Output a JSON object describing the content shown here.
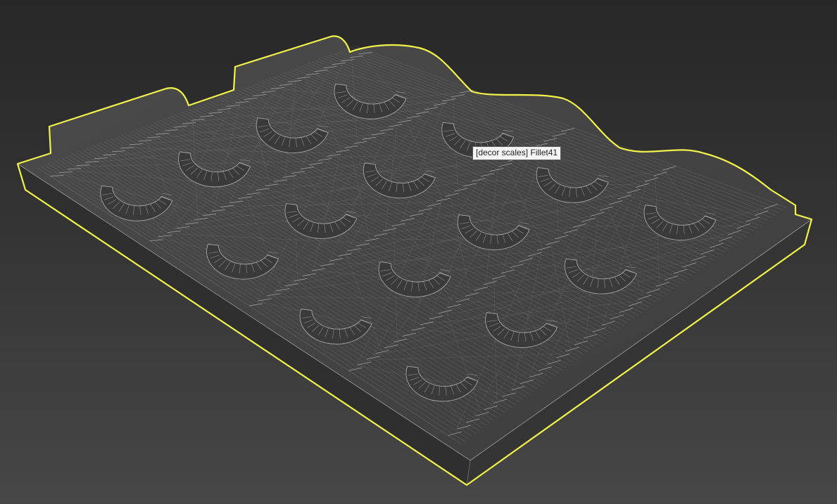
{
  "viewport": {
    "object_name": "decor scales",
    "selection_color": "#f2f24a",
    "wire_color": "#a6a6a6",
    "background_top": "#272727",
    "background_bottom": "#474747"
  },
  "tooltip": {
    "text": "[decor scales] Fillet41"
  }
}
